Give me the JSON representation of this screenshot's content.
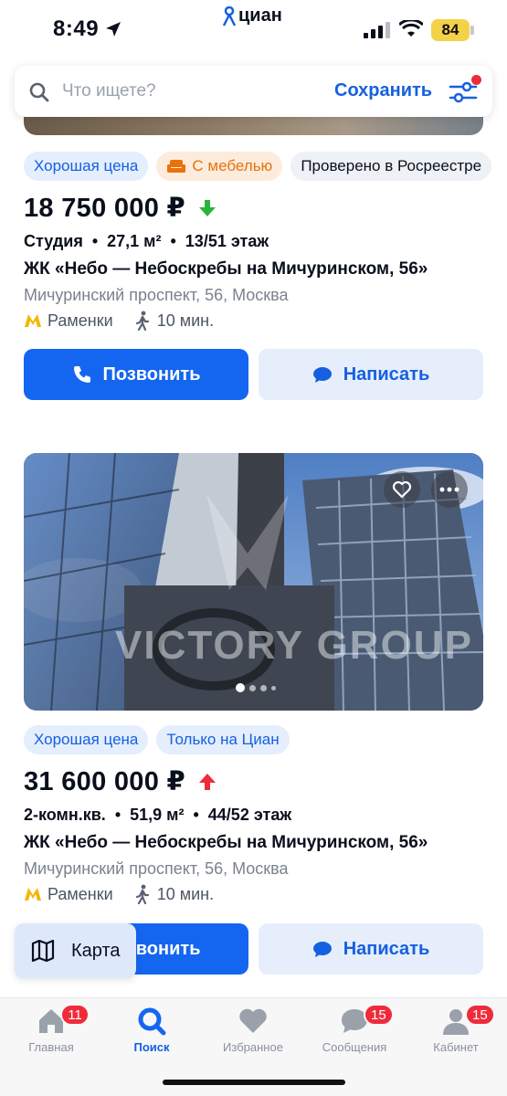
{
  "status_bar": {
    "time": "8:49",
    "brand": "циан",
    "battery": "84"
  },
  "search": {
    "placeholder": "Что ищете?",
    "save_label": "Сохранить"
  },
  "listings": [
    {
      "tags": [
        "Хорошая цена",
        "С мебелью",
        "Проверено в Росреестре"
      ],
      "price": "18 750 000 ₽",
      "price_trend": "down",
      "specs": [
        "Студия",
        "27,1 м²",
        "13/51 этаж"
      ],
      "complex": "ЖК «Небо — Небоскребы на Мичуринском, 56»",
      "address": "Мичуринский проспект, 56, Москва",
      "metro": "Раменки",
      "walk": "10 мин.",
      "call_label": "Позвонить",
      "write_label": "Написать"
    },
    {
      "watermark": "VICTORY GROUP",
      "tags": [
        "Хорошая цена",
        "Только на Циан"
      ],
      "price": "31 600 000 ₽",
      "price_trend": "up",
      "specs": [
        "2-комн.кв.",
        "51,9 м²",
        "44/52 этаж"
      ],
      "complex": "ЖК «Небо — Небоскребы на Мичуринском, 56»",
      "address": "Мичуринский проспект, 56, Москва",
      "metro": "Раменки",
      "walk": "10 мин.",
      "call_label": "Позвонить",
      "write_label": "Написать"
    }
  ],
  "map_button": {
    "label": "Карта"
  },
  "tabbar": [
    {
      "label": "Главная",
      "badge": "11",
      "icon": "home-icon"
    },
    {
      "label": "Поиск",
      "badge": "",
      "icon": "search-icon"
    },
    {
      "label": "Избранное",
      "badge": "",
      "icon": "heart-icon"
    },
    {
      "label": "Сообщения",
      "badge": "15",
      "icon": "chat-icon"
    },
    {
      "label": "Кабинет",
      "badge": "15",
      "icon": "user-icon"
    }
  ],
  "colors": {
    "accent": "#1466f0",
    "badge": "#ef2b3a",
    "price_down": "#2bb33c",
    "price_up": "#ef2b3a",
    "metro": "#f2b705"
  }
}
